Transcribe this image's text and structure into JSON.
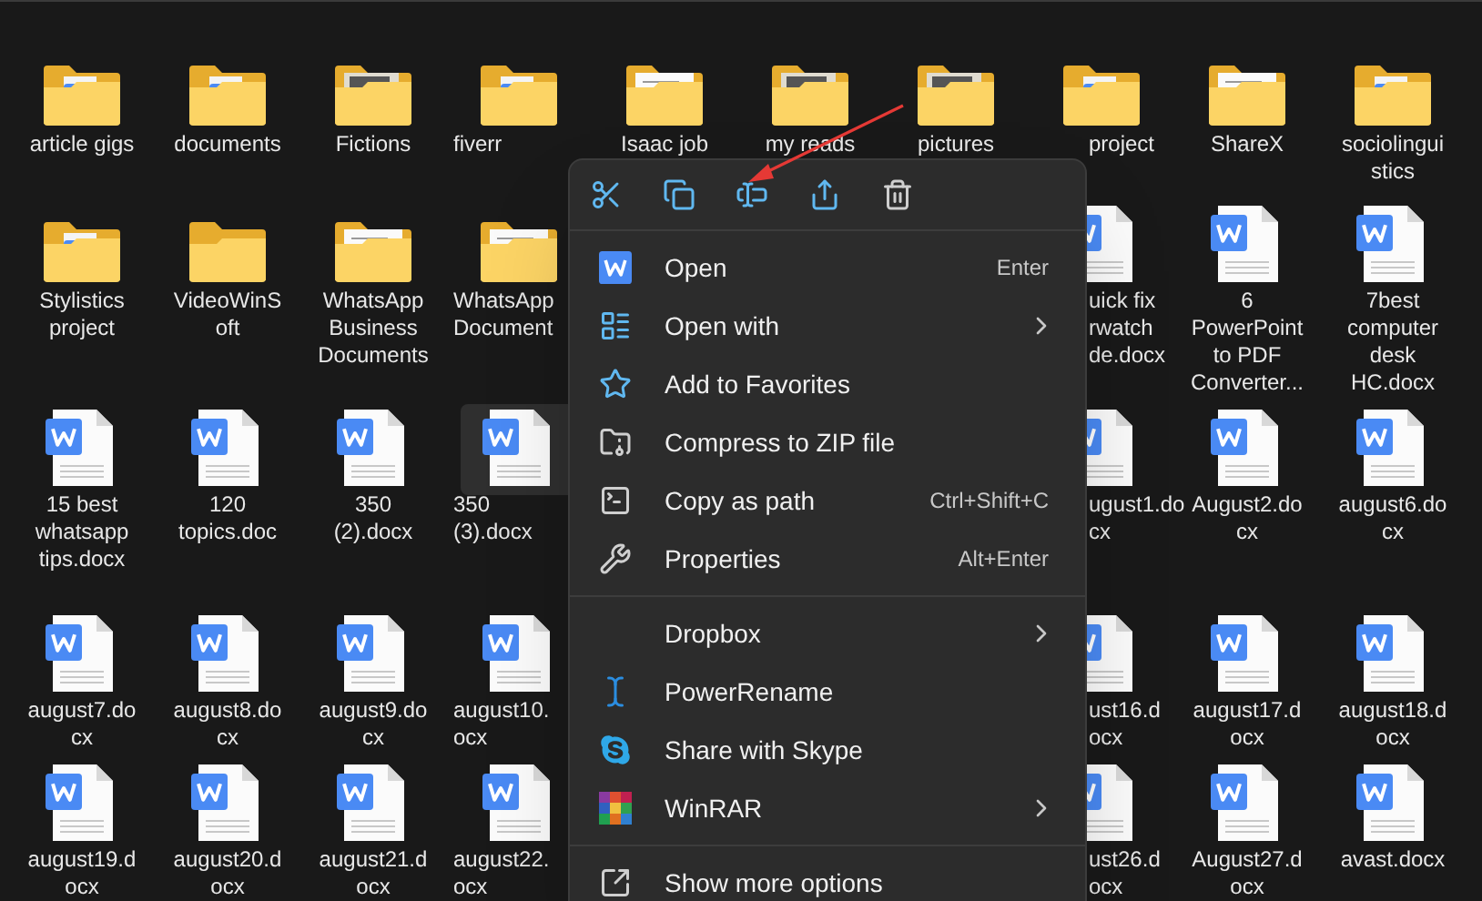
{
  "rows": [
    {
      "items": [
        {
          "kind": "folder-word",
          "lines": [
            "article gigs"
          ],
          "selected": false
        },
        {
          "kind": "folder-word",
          "lines": [
            "documents"
          ],
          "selected": false
        },
        {
          "kind": "folder-photo",
          "lines": [
            "Fictions"
          ],
          "selected": false
        },
        {
          "kind": "folder-word",
          "lines": [
            "fiverr"
          ],
          "selected": false
        },
        {
          "kind": "folder-paper",
          "lines": [
            "Isaac job"
          ],
          "selected": false
        },
        {
          "kind": "folder-photo",
          "lines": [
            "my reads"
          ],
          "selected": false
        },
        {
          "kind": "folder-photo",
          "lines": [
            "pictures"
          ],
          "selected": false
        },
        {
          "kind": "folder-word",
          "lines": [
            "project"
          ],
          "selected": false
        },
        {
          "kind": "folder-paper",
          "lines": [
            "ShareX"
          ],
          "selected": false
        },
        {
          "kind": "folder-word",
          "lines": [
            "sociolingui",
            "stics"
          ],
          "selected": false
        }
      ]
    },
    {
      "items": [
        {
          "kind": "folder-word",
          "lines": [
            "Stylistics",
            "project"
          ],
          "selected": false
        },
        {
          "kind": "folder",
          "lines": [
            "VideoWinS",
            "oft"
          ],
          "selected": false
        },
        {
          "kind": "folder-paper",
          "lines": [
            "WhatsApp",
            "Business",
            "Documents"
          ],
          "selected": false
        },
        {
          "kind": "folder-paper",
          "lines": [
            "WhatsApp",
            "Document"
          ],
          "selected": false
        },
        {
          "kind": "file-word",
          "lines": [
            "uick fix",
            "rwatch",
            "de.docx"
          ],
          "selected": false
        },
        {
          "kind": "file-word",
          "lines": [
            "6",
            "PowerPoint",
            "to PDF",
            "Converter..."
          ],
          "selected": false
        },
        {
          "kind": "file-word",
          "lines": [
            "7best",
            "computer",
            "desk",
            "HC.docx"
          ],
          "selected": false
        }
      ]
    },
    {
      "items": [
        {
          "kind": "file-word",
          "lines": [
            "15 best",
            "whatsapp",
            "tips.docx"
          ],
          "selected": false
        },
        {
          "kind": "file-word",
          "lines": [
            "120",
            "topics.doc"
          ],
          "selected": false
        },
        {
          "kind": "file-word",
          "lines": [
            "350",
            "(2).docx"
          ],
          "selected": false
        },
        {
          "kind": "file-word",
          "lines": [
            "350",
            "(3).docx"
          ],
          "selected": true
        },
        {
          "kind": "file-word",
          "lines": [
            "ugust1.do",
            "cx"
          ],
          "selected": false
        },
        {
          "kind": "file-word",
          "lines": [
            "August2.do",
            "cx"
          ],
          "selected": false
        },
        {
          "kind": "file-word",
          "lines": [
            "august6.do",
            "cx"
          ],
          "selected": false
        }
      ]
    },
    {
      "items": [
        {
          "kind": "file-word",
          "lines": [
            "august7.do",
            "cx"
          ],
          "selected": false
        },
        {
          "kind": "file-word",
          "lines": [
            "august8.do",
            "cx"
          ],
          "selected": false
        },
        {
          "kind": "file-word",
          "lines": [
            "august9.do",
            "cx"
          ],
          "selected": false
        },
        {
          "kind": "file-word",
          "lines": [
            "august10.",
            "ocx"
          ],
          "selected": false
        },
        {
          "kind": "file-word",
          "lines": [
            "ust16.d",
            "ocx"
          ],
          "selected": false
        },
        {
          "kind": "file-word",
          "lines": [
            "august17.d",
            "ocx"
          ],
          "selected": false
        },
        {
          "kind": "file-word",
          "lines": [
            "august18.d",
            "ocx"
          ],
          "selected": false
        }
      ]
    },
    {
      "items": [
        {
          "kind": "file-word",
          "lines": [
            "august19.d",
            "ocx"
          ],
          "selected": false
        },
        {
          "kind": "file-word",
          "lines": [
            "august20.d",
            "ocx"
          ],
          "selected": false
        },
        {
          "kind": "file-word",
          "lines": [
            "august21.d",
            "ocx"
          ],
          "selected": false
        },
        {
          "kind": "file-word",
          "lines": [
            "august22.",
            "ocx"
          ],
          "selected": false
        },
        {
          "kind": "file-word",
          "lines": [
            "ust26.d",
            "ocx"
          ],
          "selected": false
        },
        {
          "kind": "file-word",
          "lines": [
            "August27.d",
            "ocx"
          ],
          "selected": false
        },
        {
          "kind": "file-word",
          "lines": [
            "avast.docx"
          ],
          "selected": false
        }
      ]
    }
  ],
  "context_menu": {
    "sections": [
      [
        {
          "label": "Open",
          "shortcut": "Enter",
          "submenu": false
        },
        {
          "label": "Open with",
          "submenu": true
        },
        {
          "label": "Add to Favorites",
          "submenu": false
        },
        {
          "label": "Compress to ZIP file",
          "submenu": false
        },
        {
          "label": "Copy as path",
          "shortcut": "Ctrl+Shift+C",
          "submenu": false
        },
        {
          "label": "Properties",
          "shortcut": "Alt+Enter",
          "submenu": false
        }
      ],
      [
        {
          "label": "Dropbox",
          "submenu": true
        },
        {
          "label": "PowerRename",
          "submenu": false
        },
        {
          "label": "Share with Skype",
          "submenu": false
        },
        {
          "label": "WinRAR",
          "submenu": true
        }
      ],
      [
        {
          "label": "Show more options",
          "submenu": false
        }
      ]
    ]
  }
}
